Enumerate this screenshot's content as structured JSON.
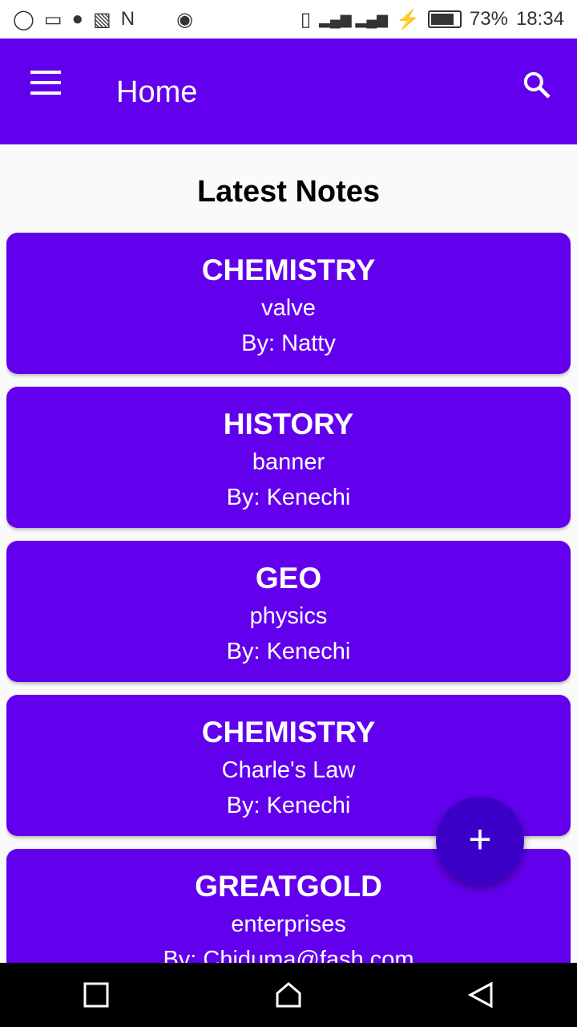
{
  "status_bar": {
    "battery": "73%",
    "time": "18:34",
    "notification_icons": [
      "whatsapp-icon",
      "message-icon",
      "chrome-icon",
      "image-icon",
      "n-icon",
      "media-icon"
    ]
  },
  "app_bar": {
    "title": "Home",
    "background": "#6200EE"
  },
  "main": {
    "heading": "Latest Notes",
    "notes": [
      {
        "subject": "CHEMISTRY",
        "topic": "valve",
        "author": "By: Natty"
      },
      {
        "subject": "HISTORY",
        "topic": "banner",
        "author": "By: Kenechi"
      },
      {
        "subject": "GEO",
        "topic": "physics",
        "author": "By: Kenechi"
      },
      {
        "subject": "CHEMISTRY",
        "topic": "Charle's Law",
        "author": "By: Kenechi"
      },
      {
        "subject": "GREATGOLD",
        "topic": "enterprises",
        "author": "By: Chiduma@fash.com"
      }
    ]
  },
  "fab": {
    "label": "+"
  }
}
